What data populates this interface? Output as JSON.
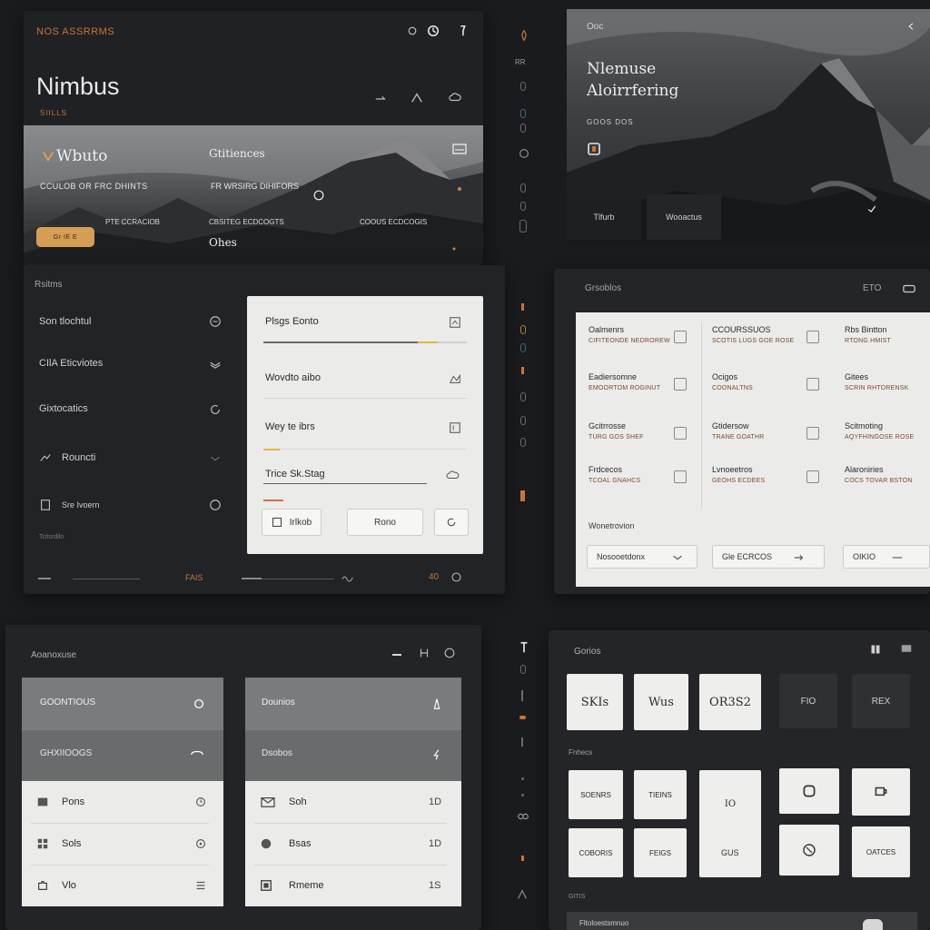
{
  "main": {
    "kicker": "NOS ASSRRMS",
    "title": "Nimbus",
    "sub": "SIILLS",
    "hero": {
      "title": "Wbuto",
      "subtitle": "CCULOB OR FRC DHINTS",
      "col2_title": "Gtitiences",
      "col2_sub": "FR WRSIRG DIHIFORS",
      "col3_title": "Ohes",
      "tag1": "PTE CCRACIOB",
      "tag2": "CBSITEG ECDCOGTS",
      "tag3": "COOUS ECDCOGIS",
      "cta": "Gr IE E"
    },
    "section_label": "Rsitms",
    "nav": [
      "Son tlochtul",
      "CIlA Eticviotes",
      "Gixtocatics",
      "Rouncti",
      "Sre Ivoern"
    ],
    "nav_foot": "Tcitsrdilo",
    "form": {
      "f1": "Plsgs Eonto",
      "f2": "Wovdto aibo",
      "f3": "Wey te ibrs",
      "f4": "Trice Sk.Stag",
      "b1": "Irlkob",
      "b2": "Rono"
    },
    "footer": {
      "left": "FAIS",
      "right": "40"
    }
  },
  "right_hero": {
    "top": "Ooc",
    "title1": "Nlemuse",
    "title2": "Aloirrfering",
    "meta": "GOOS DOS",
    "btn1": "Tlfurb",
    "btn2": "Wooactus"
  },
  "grid": {
    "title": "Grsoblos",
    "right_label": "ETO",
    "rows": [
      [
        {
          "t": "Oalmenrs",
          "s": "CIFITEONDE NEDROREW"
        },
        {
          "t": "CCOURSSUOS",
          "s": "SCOTIS LUGS GOE ROSE"
        },
        {
          "t": "Rbs Bintton",
          "s": "RTONG HMIST"
        }
      ],
      [
        {
          "t": "Eadiersomne",
          "s": "EMOORTOM ROGINUT"
        },
        {
          "t": "Ocigos",
          "s": "COONALTNS"
        },
        {
          "t": "Gitees",
          "s": "SCRIN RHTORENSK"
        }
      ],
      [
        {
          "t": "Gcitrrosse",
          "s": "TURG GOS SHEF"
        },
        {
          "t": "Gtidersow",
          "s": "TRANE GOATHR"
        },
        {
          "t": "Scitmoting",
          "s": "AQYFHINGOSE ROSE"
        }
      ],
      [
        {
          "t": "Frdcecos",
          "s": "TCOAL GNAHCS"
        },
        {
          "t": "Lvnoeetros",
          "s": "GEOHS ECDEES"
        },
        {
          "t": "Alaroniries",
          "s": "COCS TOVAR BSTON"
        }
      ]
    ],
    "footer_label": "Wonetrovion",
    "select1": "Nosooetdonx",
    "select2": "Gle ECRCOS",
    "select3": "OIKIO"
  },
  "accounts": {
    "title": "Aoanoxuse",
    "card1": {
      "h1": "GOONTIOUS",
      "h2": "GHXIIOOGS",
      "items": [
        "Pons",
        "Sols",
        "Vlo"
      ]
    },
    "card2": {
      "h1": "Dounios",
      "h2": "Dsobos",
      "items": [
        {
          "label": "Soh",
          "value": "1D"
        },
        {
          "label": "Bsas",
          "value": "1D"
        },
        {
          "label": "Rmeme",
          "value": "1S"
        }
      ]
    }
  },
  "tiles": {
    "title": "Gorios",
    "sub": "Fnhecs",
    "row1": [
      "SKIs",
      "Wus",
      "OR3S2",
      "FIO",
      "REX"
    ],
    "row2": [
      "SOENRS",
      "TIEINS",
      "IO"
    ],
    "row3": [
      "COBORIS",
      "FEIGS",
      "GUS",
      "OATCES"
    ],
    "foot": "GITIS",
    "bottom": "Fltoloestsmnuo"
  }
}
